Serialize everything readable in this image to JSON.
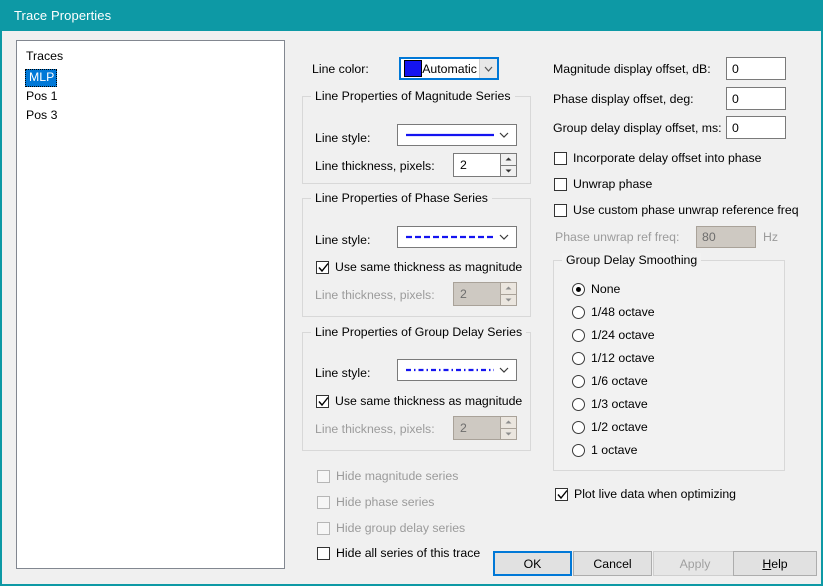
{
  "window": {
    "title": "Trace Properties",
    "accent_color": "#0d99a5",
    "background_color": "#f0f0f0"
  },
  "traces_list": {
    "header": "Traces",
    "items": [
      {
        "label": "MLP",
        "selected": true
      },
      {
        "label": "Pos 1",
        "selected": false
      },
      {
        "label": "Pos 3",
        "selected": false
      }
    ]
  },
  "line_color": {
    "label": "Line color:",
    "value": "Automatic",
    "swatch_color": "#1414f0"
  },
  "magnitude_group": {
    "title": "Line Properties of Magnitude Series",
    "line_style_label": "Line style:",
    "line_style_value": "solid",
    "thickness_label": "Line thickness, pixels:",
    "thickness_value": "2"
  },
  "phase_group": {
    "title": "Line Properties of Phase Series",
    "line_style_label": "Line style:",
    "line_style_value": "dashed",
    "same_thickness_label": "Use same thickness as magnitude",
    "same_thickness_checked": true,
    "thickness_label": "Line thickness, pixels:",
    "thickness_value": "2",
    "thickness_disabled": true
  },
  "group_delay_group": {
    "title": "Line Properties of Group Delay Series",
    "line_style_label": "Line style:",
    "line_style_value": "dash-dot",
    "same_thickness_label": "Use same thickness as magnitude",
    "same_thickness_checked": true,
    "thickness_label": "Line thickness, pixels:",
    "thickness_value": "2",
    "thickness_disabled": true
  },
  "hide_options": {
    "hide_magnitude": "Hide magnitude series",
    "hide_phase": "Hide phase series",
    "hide_group_delay": "Hide group delay series",
    "hide_all": "Hide all series of this trace"
  },
  "offsets": {
    "magnitude_label": "Magnitude display offset, dB:",
    "magnitude_value": "0",
    "phase_label": "Phase display offset, deg:",
    "phase_value": "0",
    "group_delay_label": "Group delay display offset, ms:",
    "group_delay_value": "0"
  },
  "phase_options": {
    "incorporate_delay": "Incorporate delay offset into phase",
    "unwrap_phase": "Unwrap phase",
    "use_custom_unwrap": "Use custom phase unwrap reference freq",
    "unwrap_ref_label": "Phase unwrap ref freq:",
    "unwrap_ref_value": "80",
    "unwrap_ref_unit": "Hz"
  },
  "smoothing": {
    "title": "Group Delay Smoothing",
    "options": [
      {
        "label": "None",
        "selected": true
      },
      {
        "label": "1/48 octave",
        "selected": false
      },
      {
        "label": "1/24 octave",
        "selected": false
      },
      {
        "label": "1/12 octave",
        "selected": false
      },
      {
        "label": "1/6 octave",
        "selected": false
      },
      {
        "label": "1/3 octave",
        "selected": false
      },
      {
        "label": "1/2 octave",
        "selected": false
      },
      {
        "label": "1 octave",
        "selected": false
      }
    ]
  },
  "plot_live": {
    "label": "Plot live data when optimizing",
    "checked": true
  },
  "buttons": {
    "ok": "OK",
    "cancel": "Cancel",
    "apply": "Apply",
    "help_prefix": "H",
    "help_rest": "elp"
  }
}
